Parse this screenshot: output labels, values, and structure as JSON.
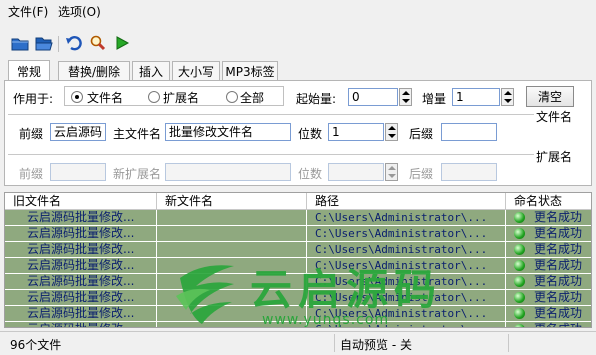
{
  "menu": {
    "file": "文件(F)",
    "options": "选项(O)"
  },
  "toolbar": {
    "icons": [
      "open-file-icon",
      "open-folder-icon",
      "undo-icon",
      "search-icon",
      "run-icon"
    ]
  },
  "tabs": [
    "常规",
    "替换/删除",
    "插入",
    "大小写",
    "MP3标签"
  ],
  "apply_to": {
    "label": "作用于:",
    "options": [
      "文件名",
      "扩展名",
      "全部"
    ],
    "selected": "文件名"
  },
  "start": {
    "label": "起始量:",
    "value": "0"
  },
  "increment": {
    "label": "增量",
    "value": "1"
  },
  "clear_label": "清空",
  "filename_section": {
    "title": "文件名",
    "prefix_label": "前缀",
    "prefix_value": "云启源码",
    "main_label": "主文件名",
    "main_value": "批量修改文件名",
    "digits_label": "位数",
    "digits_value": "1",
    "suffix_label": "后缀",
    "suffix_value": ""
  },
  "ext_section": {
    "title": "扩展名",
    "prefix_label": "前缀",
    "new_ext_label": "新扩展名",
    "digits_label": "位数",
    "suffix_label": "后缀"
  },
  "columns": [
    "旧文件名",
    "新文件名",
    "路径",
    "命名状态"
  ],
  "rows": [
    {
      "old": "云启源码批量修改...",
      "new": "",
      "path": "C:\\Users\\Administrator\\...",
      "status": "更名成功"
    },
    {
      "old": "云启源码批量修改...",
      "new": "",
      "path": "C:\\Users\\Administrator\\...",
      "status": "更名成功"
    },
    {
      "old": "云启源码批量修改...",
      "new": "",
      "path": "C:\\Users\\Administrator\\...",
      "status": "更名成功"
    },
    {
      "old": "云启源码批量修改...",
      "new": "",
      "path": "C:\\Users\\Administrator\\...",
      "status": "更名成功"
    },
    {
      "old": "云启源码批量修改...",
      "new": "",
      "path": "C:\\Users\\Administrator\\...",
      "status": "更名成功"
    },
    {
      "old": "云启源码批量修改...",
      "new": "",
      "path": "C:\\Users\\Administrator\\...",
      "status": "更名成功"
    },
    {
      "old": "云启源码批量修改...",
      "new": "",
      "path": "C:\\Users\\Administrator\\...",
      "status": "更名成功"
    },
    {
      "old": "云启源码批量修改...",
      "new": "",
      "path": "C:\\Users\\Administrator\\...",
      "status": "更名成功"
    }
  ],
  "statusbar": {
    "file_count": "96个文件",
    "preview": "自动预览 - 关"
  },
  "watermark": {
    "text": "云启源码",
    "url": "www.yunqs.com"
  },
  "colors": {
    "row_bg": "#8fa97f",
    "accent": "#2aa63c",
    "status_ok": "#1fa21f"
  }
}
